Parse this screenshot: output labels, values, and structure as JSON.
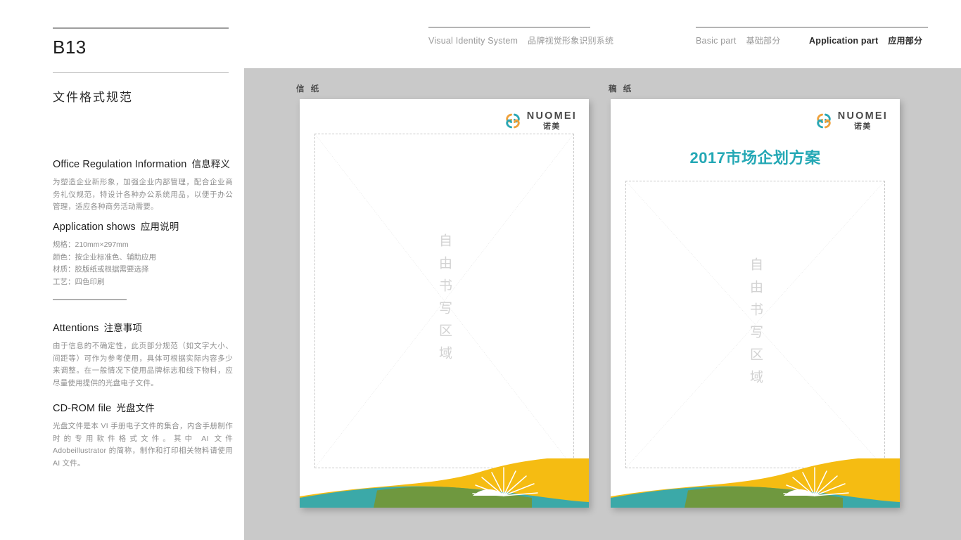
{
  "header": {
    "visual_identity": {
      "en": "Visual Identity System",
      "cn": "品牌视觉形象识别系统"
    },
    "basic_part": {
      "en": "Basic part",
      "cn": "基础部分"
    },
    "application_part": {
      "en": "Application part",
      "cn": "应用部分"
    }
  },
  "sidebar": {
    "page_code": "B13",
    "page_subject": "文件格式规范",
    "sections": [
      {
        "title_en": "Office Regulation Information",
        "title_cn": "信息释义",
        "body": "为塑造企业新形象，加强企业内部管理，配合企业商务礼仪规范，特设计各种办公系统用品，以便于办公管理，适应各种商务活动需要。"
      },
      {
        "title_en": "Application shows",
        "title_cn": "应用说明",
        "specs": [
          "规格：210mm×297mm",
          "颜色：按企业标准色、辅助应用",
          "材质：胶版纸或根据需要选择",
          "工艺：四色印刷"
        ]
      },
      {
        "title_en": "Attentions",
        "title_cn": "注意事项",
        "body": "由于信息的不确定性，此页部分规范（如文字大小、间距等）可作为参考使用，具体可根据实际内容多少来调整。在一般情况下使用品牌标志和线下物料，应尽量使用提供的光盘电子文件。"
      },
      {
        "title_en": "CD-ROM file",
        "title_cn": "光盘文件",
        "body": "光盘文件是本 VI 手册电子文件的集合，内含手册制作时的专用软件格式文件。其中 AI 文件 Adobeillustrator 的简称，制作和打印相关物料请使用 AI 文件。"
      }
    ]
  },
  "stage": {
    "letterhead": {
      "caption": "信 纸",
      "logo": {
        "en": "NUOMEI",
        "cn": "诺美"
      },
      "watermark": "自由书写区域",
      "title": ""
    },
    "draftpaper": {
      "caption": "稿 纸",
      "logo": {
        "en": "NUOMEI",
        "cn": "诺美"
      },
      "watermark": "自由书写区域",
      "title": "2017市场企划方案"
    }
  },
  "colors": {
    "brand_teal": "#24a8b5",
    "brand_orange": "#f0a13c",
    "wave_yellow": "#f5bc12",
    "wave_teal": "#2aa7b5",
    "wave_overlap": "#6f983f",
    "stage_gray": "#c9c9c9",
    "body_text_gray": "#8e8e8e"
  }
}
